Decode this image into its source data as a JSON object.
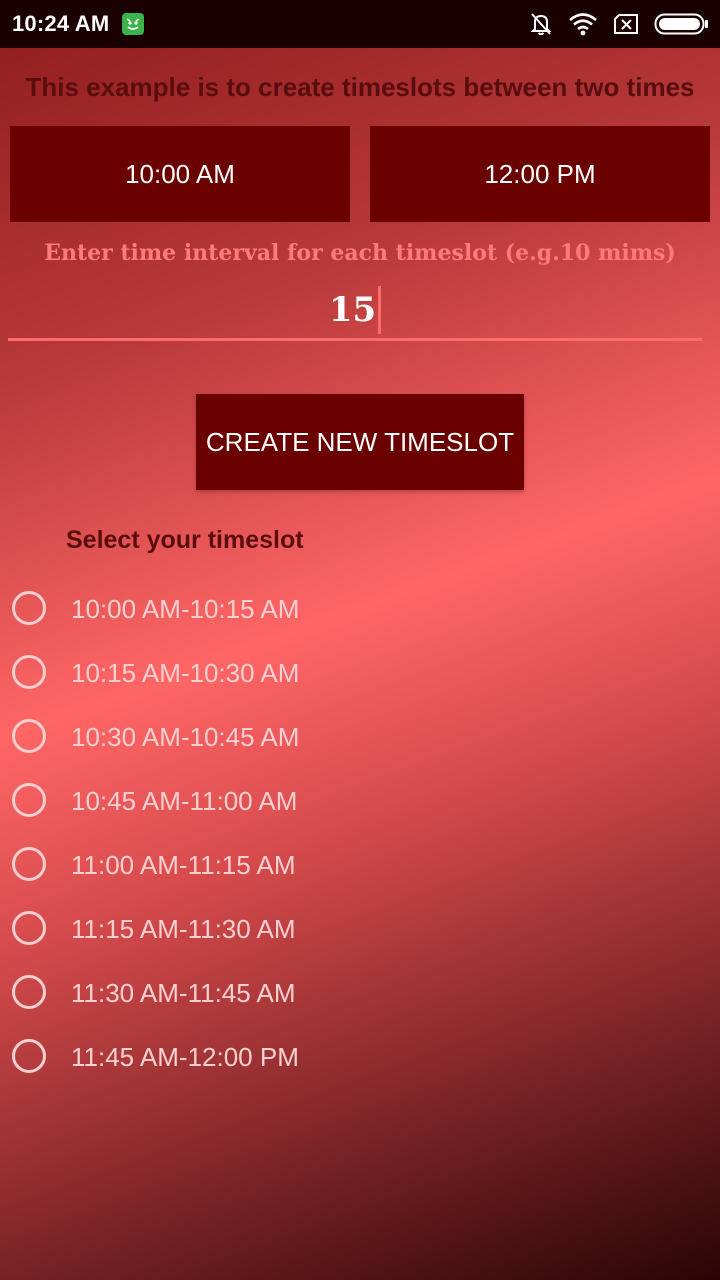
{
  "status_bar": {
    "time": "10:24 AM",
    "icons": [
      "app-notification-icon",
      "bell-off-icon",
      "wifi-icon",
      "sim-none-icon",
      "battery-icon"
    ]
  },
  "heading": "This example is to create timeslots between two times",
  "start_time": "10:00 AM",
  "end_time": "12:00 PM",
  "interval": {
    "label": "Enter time interval for each timeslot (e.g.10 mims)",
    "value": "15"
  },
  "create_button_label": "CREATE NEW TIMESLOT",
  "select_title": "Select your timeslot",
  "timeslots": [
    {
      "label": "10:00 AM-10:15 AM"
    },
    {
      "label": "10:15 AM-10:30 AM"
    },
    {
      "label": "10:30 AM-10:45 AM"
    },
    {
      "label": "10:45 AM-11:00 AM"
    },
    {
      "label": "11:00 AM-11:15 AM"
    },
    {
      "label": "11:15 AM-11:30 AM"
    },
    {
      "label": "11:30 AM-11:45 AM"
    },
    {
      "label": "11:45 AM-12:00 PM"
    }
  ],
  "colors": {
    "accent": "#6b0000",
    "underline": "#ff6b6b",
    "radio": "#ffd0d0",
    "heading_text": "#5a0d0e"
  }
}
